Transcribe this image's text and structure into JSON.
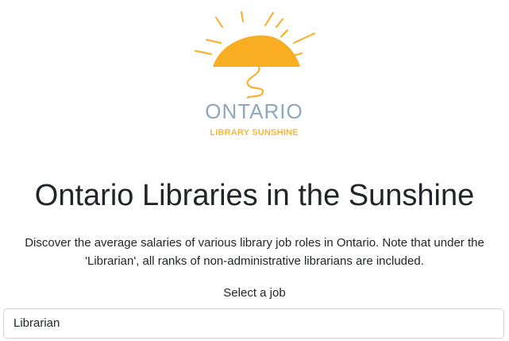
{
  "logo": {
    "word": "ONTARIO",
    "subtitle": "LIBRARY SUNSHINE",
    "sun_color": "#f9ad22",
    "word_color": "#8ea6be",
    "subtitle_color": "#f6b73c"
  },
  "header": {
    "title": "Ontario Libraries in the Sunshine"
  },
  "intro": {
    "description": "Discover the average salaries of various library job roles in Ontario. Note that under the 'Librarian', all ranks of non-administrative librarians are included."
  },
  "job_select": {
    "label": "Select a job",
    "selected_value": "Librarian"
  }
}
